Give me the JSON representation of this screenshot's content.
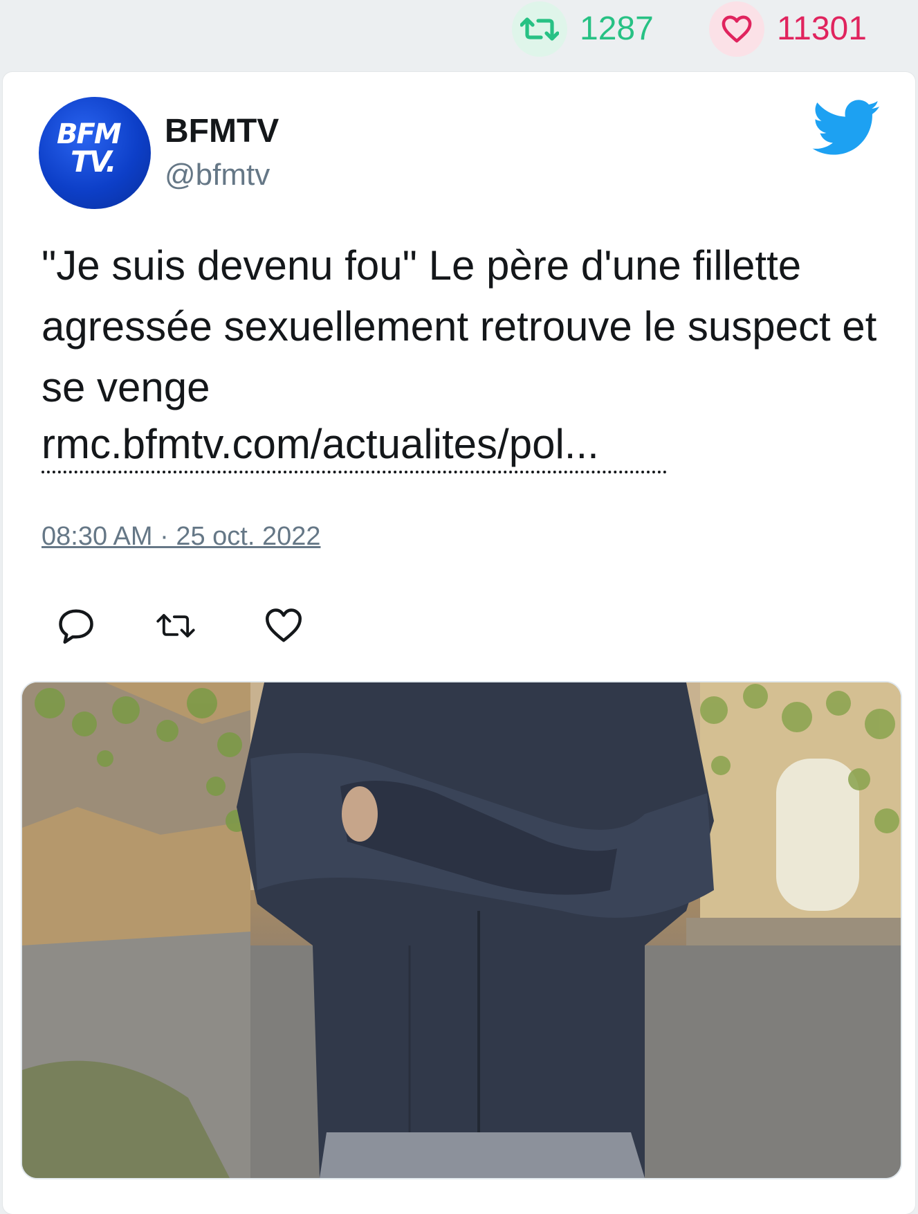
{
  "stats": {
    "retweets": "1287",
    "likes": "11301",
    "retweet_icon": "retweet-icon",
    "like_icon": "heart-icon",
    "retweet_color": "#27c184",
    "like_color": "#e0245e"
  },
  "tweet": {
    "author_name": "BFMTV",
    "author_handle": "@bfmtv",
    "avatar_logo_line1": "BFM",
    "avatar_logo_line2": "TV.",
    "text": "\"Je suis devenu fou\" Le père d'une fillette agressée sexuellement retrouve le suspect et se venge",
    "link": "rmc.bfmtv.com/actualites/pol...",
    "timestamp": "08:30 AM · 25 oct. 2022",
    "brand_color": "#1da1f2",
    "actions": [
      "reply-icon",
      "retweet-icon",
      "heart-icon"
    ],
    "media": "photo-of-person-in-dark-jacket-arms-crossed"
  }
}
